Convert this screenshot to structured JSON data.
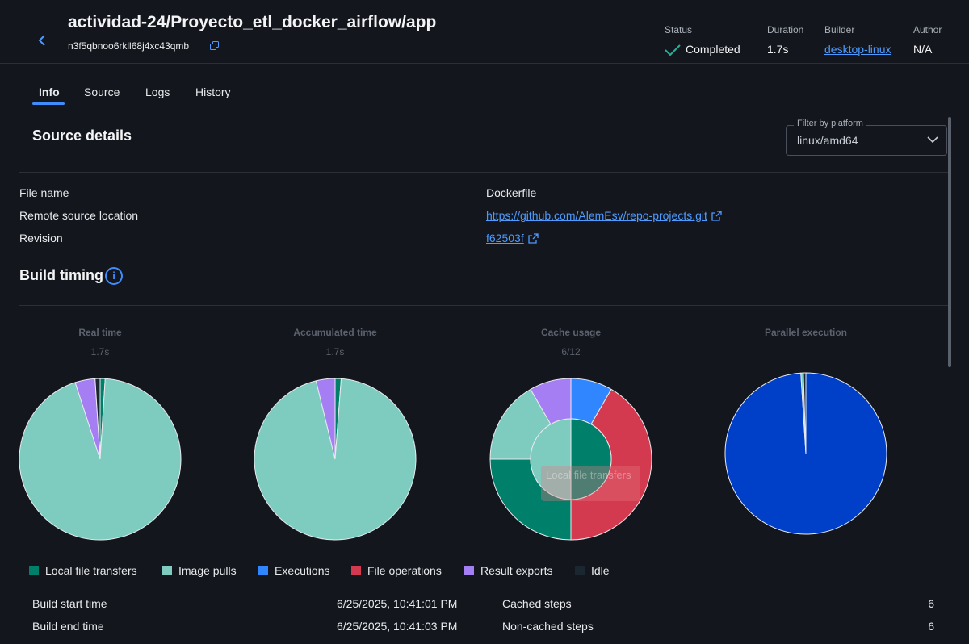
{
  "header": {
    "title": "actividad-24/Proyecto_etl_docker_airflow/app",
    "hash": "n3f5qbnoo6rkll68j4xc43qmb",
    "status": {
      "label": "Status",
      "value": "Completed"
    },
    "duration": {
      "label": "Duration",
      "value": "1.7s"
    },
    "builder": {
      "label": "Builder",
      "value": "desktop-linux"
    },
    "author": {
      "label": "Author",
      "value": "N/A"
    }
  },
  "tabs": [
    {
      "label": "Info",
      "active": true
    },
    {
      "label": "Source"
    },
    {
      "label": "Logs"
    },
    {
      "label": "History"
    }
  ],
  "source_details": {
    "title": "Source details",
    "filter": {
      "legend": "Filter by platform",
      "value": "linux/amd64"
    },
    "rows": [
      {
        "label": "File name",
        "value": "Dockerfile"
      },
      {
        "label": "Remote source location",
        "value": "https://github.com/AlemEsv/repo-projects.git"
      },
      {
        "label": "Revision",
        "value": "f62503f"
      }
    ]
  },
  "build_timing": {
    "title": "Build timing",
    "tooltip": "Local file transfers"
  },
  "colors": {
    "local_file_transfers": "#00806a",
    "image_pulls": "#7ecbc0",
    "executions": "#2f86ff",
    "file_operations": "#d43a4f",
    "result_exports": "#a67ef4",
    "idle": "#1c2630",
    "parallel": "#0040c8"
  },
  "chart_data": [
    {
      "type": "pie",
      "title": "Real time",
      "subtitle": "1.7s",
      "slices": [
        {
          "name": "Local file transfers",
          "value": 1.0
        },
        {
          "name": "Image pulls",
          "value": 94.0
        },
        {
          "name": "Result exports",
          "value": 4.0
        },
        {
          "name": "Idle",
          "value": 1.0
        }
      ]
    },
    {
      "type": "pie",
      "title": "Accumulated time",
      "subtitle": "1.7s",
      "slices": [
        {
          "name": "Local file transfers",
          "value": 1.2
        },
        {
          "name": "Image pulls",
          "value": 95.0
        },
        {
          "name": "Result exports",
          "value": 3.8
        }
      ]
    },
    {
      "type": "pie",
      "title": "Cache usage",
      "subtitle": "6/12",
      "outer": [
        {
          "name": "Executions",
          "value": 1
        },
        {
          "name": "File operations",
          "value": 5
        },
        {
          "name": "Local file transfers",
          "value": 3
        },
        {
          "name": "Image pulls",
          "value": 2
        },
        {
          "name": "Result exports",
          "value": 1
        }
      ],
      "inner": [
        {
          "name": "Local file transfers",
          "value": 1
        },
        {
          "name": "Image pulls",
          "value": 1
        }
      ]
    },
    {
      "type": "pie",
      "title": "Parallel execution",
      "subtitle": "",
      "slices": [
        {
          "name": "Parallel",
          "value": 99.0
        },
        {
          "name": "Image pulls",
          "value": 0.5
        },
        {
          "name": "Idle",
          "value": 0.5
        }
      ]
    }
  ],
  "legend": [
    {
      "label": "Local file transfers",
      "color": "#00806a"
    },
    {
      "label": "Image pulls",
      "color": "#7ecbc0"
    },
    {
      "label": "Executions",
      "color": "#2f86ff"
    },
    {
      "label": "File operations",
      "color": "#d43a4f"
    },
    {
      "label": "Result exports",
      "color": "#a67ef4"
    },
    {
      "label": "Idle",
      "color": "#1c2630"
    }
  ],
  "summary": {
    "start_label": "Build start time",
    "start_value": "6/25/2025, 10:41:01 PM",
    "end_label": "Build end time",
    "end_value": "6/25/2025, 10:41:03 PM",
    "cached_label": "Cached steps",
    "cached_value": "6",
    "noncached_label": "Non-cached steps",
    "noncached_value": "6"
  }
}
